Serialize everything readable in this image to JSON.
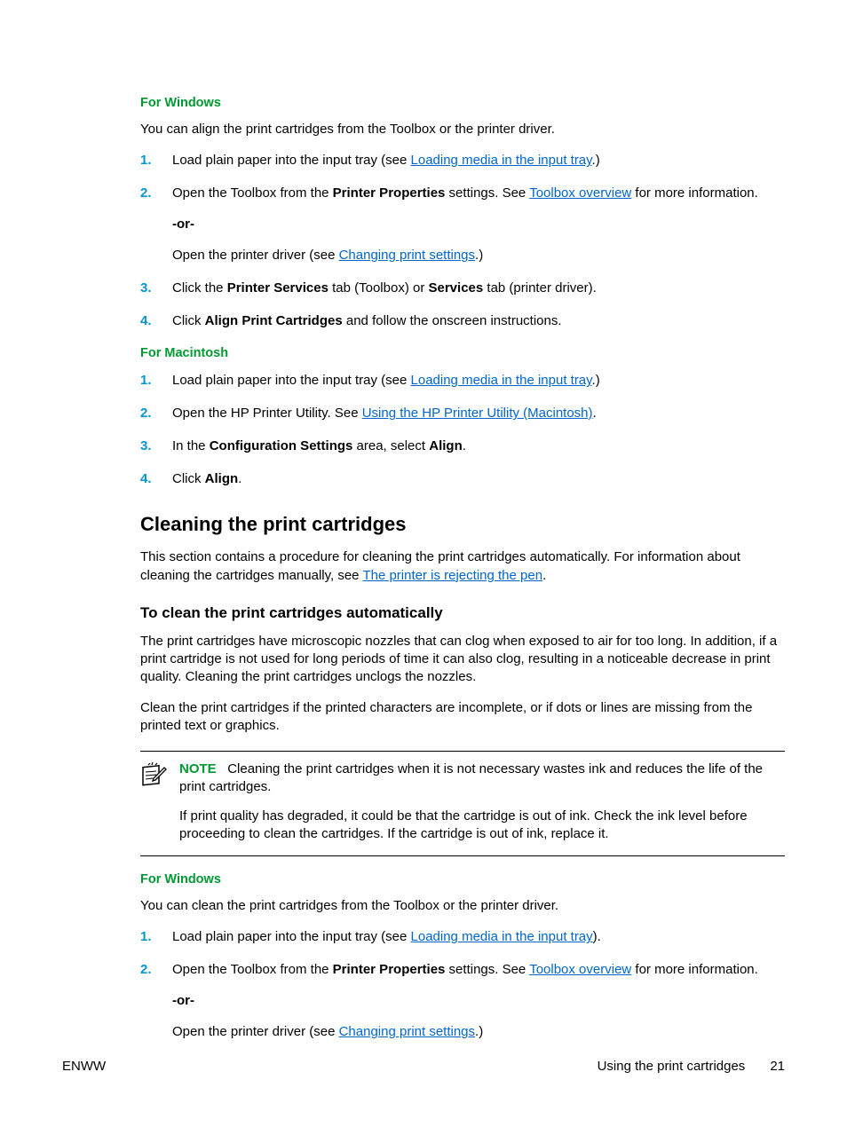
{
  "win1": {
    "heading": "For Windows",
    "intro": "You can align the print cartridges from the Toolbox or the printer driver.",
    "s1a": "Load plain paper into the input tray (see ",
    "s1link": "Loading media in the input tray",
    "s1b": ".)",
    "s2a": "Open the Toolbox from the ",
    "s2bold": "Printer Properties",
    "s2b": " settings. See ",
    "s2link": "Toolbox overview",
    "s2c": " for more information.",
    "s2or": "-or-",
    "s2d": "Open the printer driver (see ",
    "s2link2": "Changing print settings",
    "s2e": ".)",
    "s3a": "Click the ",
    "s3b1": "Printer Services",
    "s3c": " tab (Toolbox) or ",
    "s3b2": "Services",
    "s3d": " tab (printer driver).",
    "s4a": "Click ",
    "s4bold": "Align Print Cartridges",
    "s4b": " and follow the onscreen instructions."
  },
  "mac": {
    "heading": "For Macintosh",
    "s1a": "Load plain paper into the input tray (see ",
    "s1link": "Loading media in the input tray",
    "s1b": ".)",
    "s2a": "Open the HP Printer Utility. See ",
    "s2link": "Using the HP Printer Utility (Macintosh)",
    "s2b": ".",
    "s3a": "In the ",
    "s3b1": "Configuration Settings",
    "s3c": " area, select ",
    "s3b2": "Align",
    "s3d": ".",
    "s4a": "Click ",
    "s4bold": "Align",
    "s4b": "."
  },
  "clean": {
    "title": "Cleaning the print cartridges",
    "intro1": "This section contains a procedure for cleaning the print cartridges automatically. For information about cleaning the cartridges manually, see ",
    "introLink": "The printer is rejecting the pen",
    "intro2": ".",
    "subheading": "To clean the print cartridges automatically",
    "p1": "The print cartridges have microscopic nozzles that can clog when exposed to air for too long. In addition, if a print cartridge is not used for long periods of time it can also clog, resulting in a noticeable decrease in print quality. Cleaning the print cartridges unclogs the nozzles.",
    "p2": "Clean the print cartridges if the printed characters are incomplete, or if dots or lines are missing from the printed text or graphics.",
    "noteLabel": "NOTE",
    "note1": "Cleaning the print cartridges when it is not necessary wastes ink and reduces the life of the print cartridges.",
    "note2": "If print quality has degraded, it could be that the cartridge is out of ink. Check the ink level before proceeding to clean the cartridges. If the cartridge is out of ink, replace it."
  },
  "win2": {
    "heading": "For Windows",
    "intro": "You can clean the print cartridges from the Toolbox or the printer driver.",
    "s1a": "Load plain paper into the input tray (see ",
    "s1link": "Loading media in the input tray",
    "s1b": ").",
    "s2a": "Open the Toolbox from the ",
    "s2bold": "Printer Properties",
    "s2b": " settings. See ",
    "s2link": "Toolbox overview",
    "s2c": " for more information.",
    "s2or": "-or-",
    "s2d": "Open the printer driver (see ",
    "s2link2": "Changing print settings",
    "s2e": ".)"
  },
  "footer": {
    "left": "ENWW",
    "section": "Using the print cartridges",
    "page": "21"
  }
}
